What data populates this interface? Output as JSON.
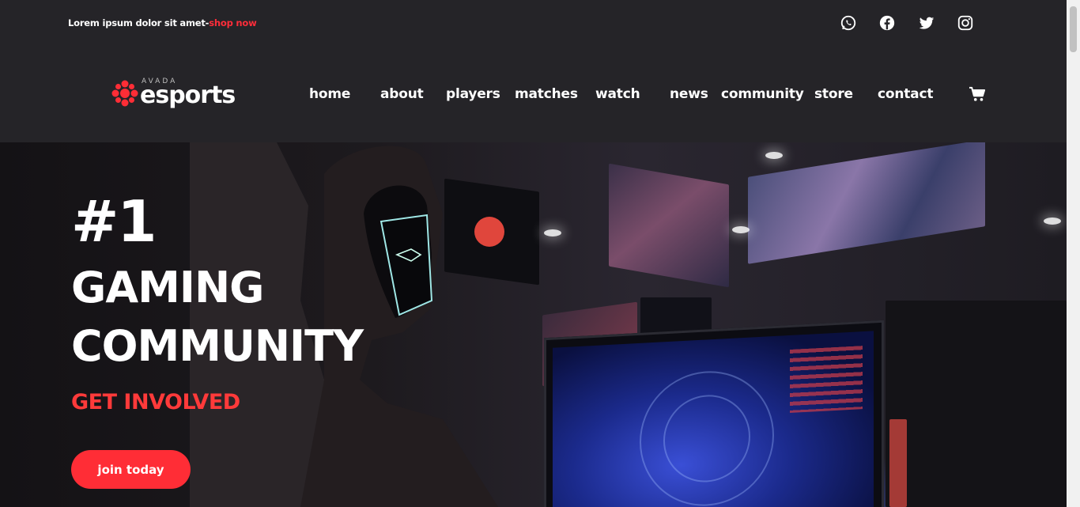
{
  "promo": {
    "text": "Lorem ipsum dolor sit amet",
    "separator": "-",
    "link": "shop now"
  },
  "social": [
    {
      "icon": "whatsapp-icon"
    },
    {
      "icon": "facebook-icon"
    },
    {
      "icon": "twitter-icon"
    },
    {
      "icon": "instagram-icon"
    }
  ],
  "logo": {
    "small": "AVADA",
    "word": "esports"
  },
  "nav": [
    "home",
    "about",
    "players",
    "matches",
    "watch",
    "news",
    "community",
    "store",
    "contact"
  ],
  "cart": {
    "icon": "cart-icon"
  },
  "hero": {
    "rank": "#1",
    "line1": "GAMING",
    "line2": "COMMUNITY",
    "subtitle": "GET INVOLVED",
    "cta": "join today"
  },
  "colors": {
    "accent": "#ff2d36",
    "header_bg": "#252428",
    "hero_bg": "#1b1a1c"
  }
}
